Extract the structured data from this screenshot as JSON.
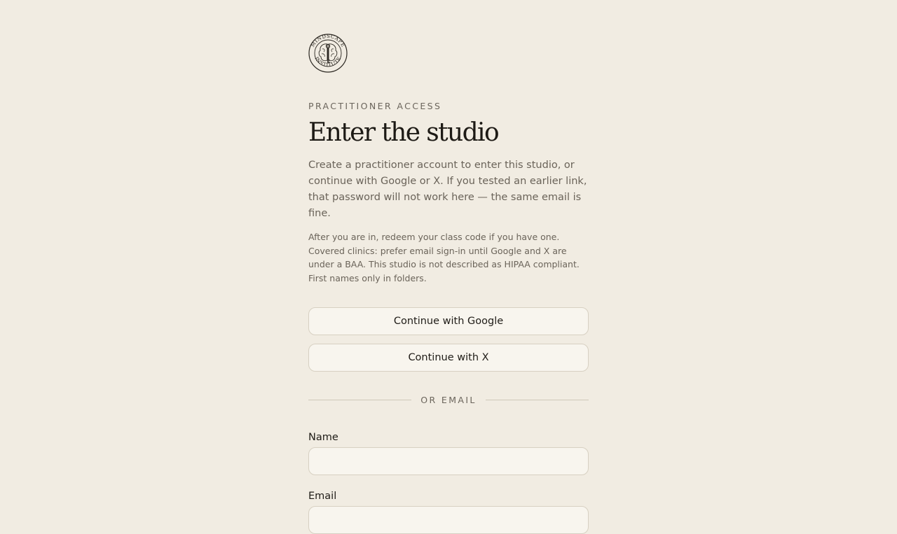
{
  "logo": {
    "name": "Mindscape Institute seal",
    "text_top": "MINDSCAPE",
    "text_bottom": "INSTITUTE"
  },
  "header": {
    "eyebrow": "PRACTITIONER ACCESS",
    "title": "Enter the studio"
  },
  "intro": {
    "lead": "Create a practitioner account to enter this studio, or continue with Google or X. If you tested an earlier link, that password will not work here — the same email is fine.",
    "fine_print": "After you are in, redeem your class code if you have one. Covered clinics: prefer email sign-in until Google and X are under a BAA. This studio is not described as HIPAA compliant. First names only in folders."
  },
  "auth": {
    "google_label": "Continue with Google",
    "x_label": "Continue with X",
    "divider_label": "OR EMAIL"
  },
  "form": {
    "name_label": "Name",
    "name_value": "",
    "email_label": "Email",
    "email_value": ""
  }
}
